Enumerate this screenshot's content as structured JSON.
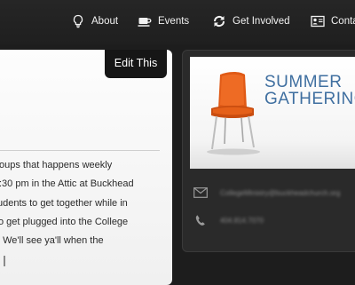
{
  "nav": {
    "items": [
      {
        "label": "About",
        "icon": "lightbulb-icon"
      },
      {
        "label": "Events",
        "icon": "coffee-cup-icon"
      },
      {
        "label": "Get Involved",
        "icon": "cycle-arrows-icon"
      },
      {
        "label": "Conta",
        "icon": "contact-card-icon"
      }
    ]
  },
  "content": {
    "edit_label": "Edit This",
    "lines": [
      "oups that happens weekly",
      ":30 pm in the Attic at Buckhead",
      "udents to get together while in",
      "o get plugged into the College",
      "! We'll see ya'll when the"
    ]
  },
  "sidebar": {
    "banner": {
      "line1": "SUMMER",
      "line2": "GATHERING"
    },
    "email": "CollegeMinistry@buckheadchurch.org",
    "phone": "404.814.7070"
  },
  "colors": {
    "nav_bg": "#222222",
    "page_bg": "#1d1d1d",
    "card_bg": "#f5f5f5",
    "banner_text": "#3f6fa0",
    "chair": "#e05a16"
  }
}
